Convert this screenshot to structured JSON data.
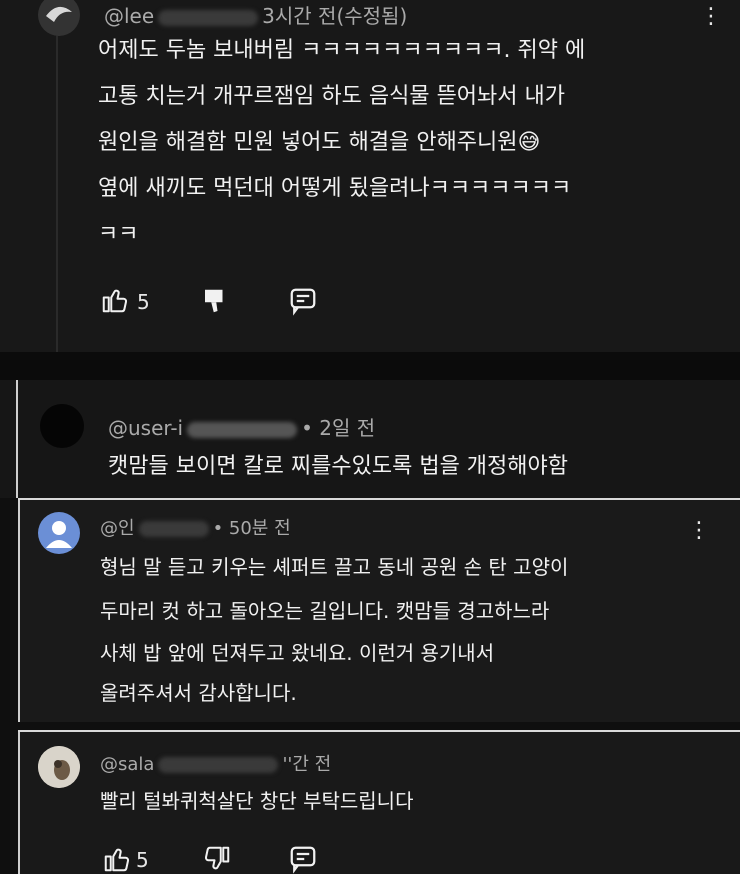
{
  "comments": [
    {
      "handle": "@lee",
      "time": "3시간 전(수정됨)",
      "lines": [
        "어제도 두놈 보내버림 ㅋㅋㅋㅋㅋㅋㅋㅋㅋㅋ. 쥐약 에",
        "고통 치는거 개꾸르잼임 하도 음식물 뜯어놔서 내가",
        "원인을 해결함 민원 넣어도 해결을 안해주니원😅",
        "옆에 새끼도 먹던대 어떻게 됬을려나ㅋㅋㅋㅋㅋㅋㅋ",
        "ㅋㅋ"
      ],
      "likes": "5"
    },
    {
      "handle": "@user-i",
      "time": "• 2일 전",
      "lines": [
        "캣맘들 보이면 칼로 찌를수있도록 법을 개정해야함"
      ]
    },
    {
      "handle": "@인",
      "time": "• 50분 전",
      "lines": [
        "형님 말 듣고 키우는 셰퍼트 끌고 동네 공원 손 탄 고양이",
        "두마리 컷 하고 돌아오는 길입니다. 캣맘들 경고하느라",
        "사체 밥 앞에 던져두고 왔네요. 이런거 용기내서",
        "올려주셔서 감사합니다."
      ]
    },
    {
      "handle": "@sala",
      "time": "''간 전",
      "lines": [
        "빨리 털봐퀴척살단 창단 부탁드립니다"
      ],
      "likes": "5"
    }
  ],
  "icons": {
    "like": "thumbs-up-icon",
    "dislike": "thumbs-down-icon",
    "reply": "reply-icon",
    "more": "more-vert-icon"
  }
}
